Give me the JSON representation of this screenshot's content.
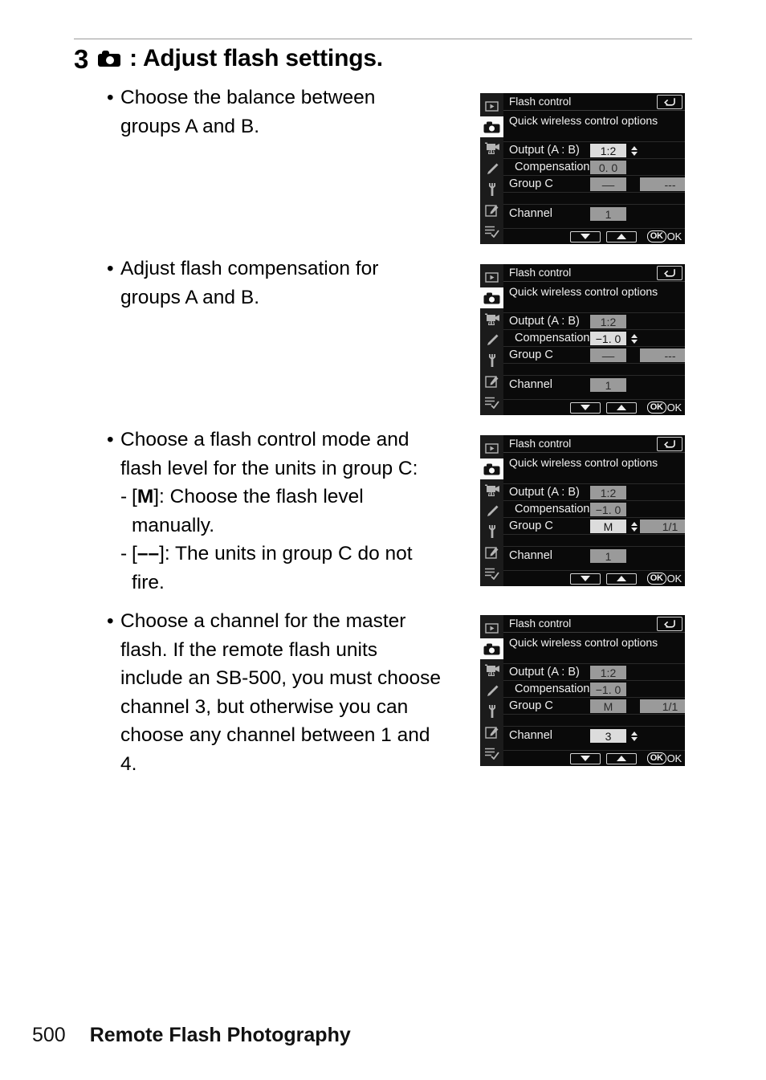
{
  "page": {
    "number": "500",
    "footer_title": "Remote Flash Photography"
  },
  "heading": {
    "step_number": "3",
    "icon": "camera-icon",
    "text": ": Adjust flash settings."
  },
  "instructions": [
    {
      "bullet": "•",
      "lines": [
        "Choose the balance between",
        "groups A and B."
      ]
    },
    {
      "bullet": "•",
      "lines": [
        "Adjust flash compensation for",
        "groups A and B."
      ]
    },
    {
      "bullet": "•",
      "lines": [
        "Choose a flash control mode and",
        "flash level for the units in group C:"
      ],
      "subitems": [
        {
          "dash": "-",
          "prefix": "[",
          "bold": "M",
          "suffix": "]: Choose the flash level",
          "line2": "manually."
        },
        {
          "dash": "-",
          "prefix": "[",
          "bold": "––",
          "suffix": "]: The units in group C do not",
          "line2": "fire."
        }
      ]
    },
    {
      "bullet": "•",
      "lines": [
        "Choose a channel for the master",
        "flash. If the remote flash units",
        "include an SB-500, you must choose",
        "channel 3, but otherwise you can",
        "choose any channel between 1 and",
        "4."
      ]
    }
  ],
  "lcd_common": {
    "title": "Flash control",
    "subtitle": "Quick wireless control options",
    "back_icon": "return-arrow-icon",
    "rail_icons": [
      "playback-icon",
      "photo-shooting-menu-icon",
      "movie-shooting-menu-icon",
      "custom-settings-pencil-icon",
      "setup-wrench-icon",
      "retouch-menu-icon",
      "recent-settings-icon"
    ],
    "rail_active_index": 1,
    "labels": {
      "output": "Output (A : B)",
      "compensation": "Compensation",
      "group_c": "Group C",
      "channel": "Channel"
    },
    "footer": {
      "down_button": "down-arrow-button",
      "up_button": "up-arrow-button",
      "ok_box": "OK",
      "ok_label": "OK"
    },
    "colors": {
      "screen_bg": "#0a0a0a",
      "rail_bg": "#1b1b1b",
      "selected_field": "#dcdcdc",
      "unselected_field": "#9a9a9a",
      "text": "#f2f2f2"
    }
  },
  "lcd_screens": [
    {
      "name": "output-balance-screen",
      "output": {
        "value": "1:2",
        "selected": true,
        "spinner": true
      },
      "compensation": {
        "value": "0. 0",
        "selected": false,
        "spinner": false
      },
      "group_c": {
        "mode": "––",
        "mode_selected": false,
        "mode_spinner": false,
        "level": "---"
      },
      "channel": {
        "value": "1",
        "selected": false,
        "spinner": false
      }
    },
    {
      "name": "compensation-screen",
      "output": {
        "value": "1:2",
        "selected": false,
        "spinner": false
      },
      "compensation": {
        "value": "−1. 0",
        "selected": true,
        "spinner": true
      },
      "group_c": {
        "mode": "––",
        "mode_selected": false,
        "mode_spinner": false,
        "level": "---"
      },
      "channel": {
        "value": "1",
        "selected": false,
        "spinner": false
      }
    },
    {
      "name": "group-c-mode-screen",
      "output": {
        "value": "1:2",
        "selected": false,
        "spinner": false
      },
      "compensation": {
        "value": "−1. 0",
        "selected": false,
        "spinner": false
      },
      "group_c": {
        "mode": "M",
        "mode_selected": true,
        "mode_spinner": true,
        "level": "1/1"
      },
      "channel": {
        "value": "1",
        "selected": false,
        "spinner": false
      }
    },
    {
      "name": "channel-screen",
      "output": {
        "value": "1:2",
        "selected": false,
        "spinner": false
      },
      "compensation": {
        "value": "−1. 0",
        "selected": false,
        "spinner": false
      },
      "group_c": {
        "mode": "M",
        "mode_selected": false,
        "mode_spinner": false,
        "level": "1/1"
      },
      "channel": {
        "value": "3",
        "selected": true,
        "spinner": true
      }
    }
  ]
}
